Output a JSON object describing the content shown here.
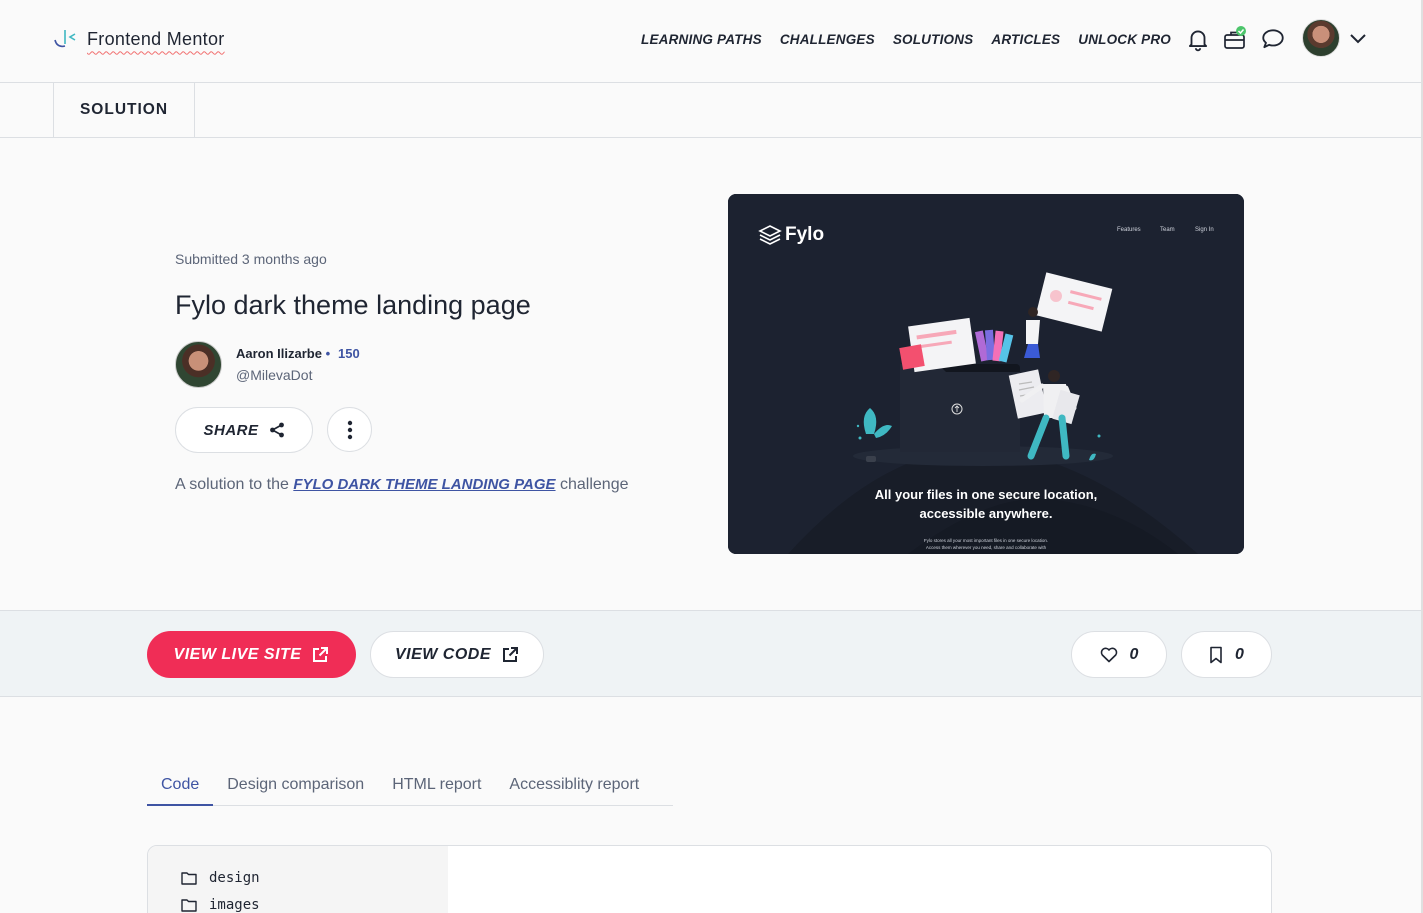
{
  "brand": {
    "name": "Frontend Mentor"
  },
  "nav": {
    "links": [
      "LEARNING PATHS",
      "CHALLENGES",
      "SOLUTIONS",
      "ARTICLES",
      "UNLOCK PRO"
    ],
    "icons": [
      "bell-icon",
      "briefcase-icon",
      "chat-bubble-icon"
    ]
  },
  "subheader": {
    "tab": "SOLUTION"
  },
  "solution": {
    "submitted": "Submitted 3 months ago",
    "title": "Fylo dark theme landing page",
    "author_name": "Aaron Ilizarbe",
    "author_dot": "•",
    "author_score": "150",
    "author_handle": "@MilevaDot",
    "share_label": "SHARE",
    "desc_prefix": "A solution to the",
    "challenge_link": "FYLO DARK THEME LANDING PAGE",
    "desc_suffix": "challenge"
  },
  "preview": {
    "brand": "Fylo",
    "nav": [
      "Features",
      "Team",
      "Sign In"
    ],
    "headline_line1": "All your files in one secure location,",
    "headline_line2": "accessible anywhere.",
    "sub_line1": "Fylo stores all your most important files in one secure location.",
    "sub_line2": "Access them wherever you need, share and collaborate with"
  },
  "actions": {
    "live_label": "VIEW LIVE SITE",
    "code_label": "VIEW CODE",
    "likes": "0",
    "bookmarks": "0"
  },
  "tabs": [
    "Code",
    "Design comparison",
    "HTML report",
    "Accessiblity report"
  ],
  "files": [
    "design",
    "images"
  ],
  "colors": {
    "accent": "#f02d56",
    "link": "#3e54a3",
    "preview_bg": "#1c2230"
  }
}
